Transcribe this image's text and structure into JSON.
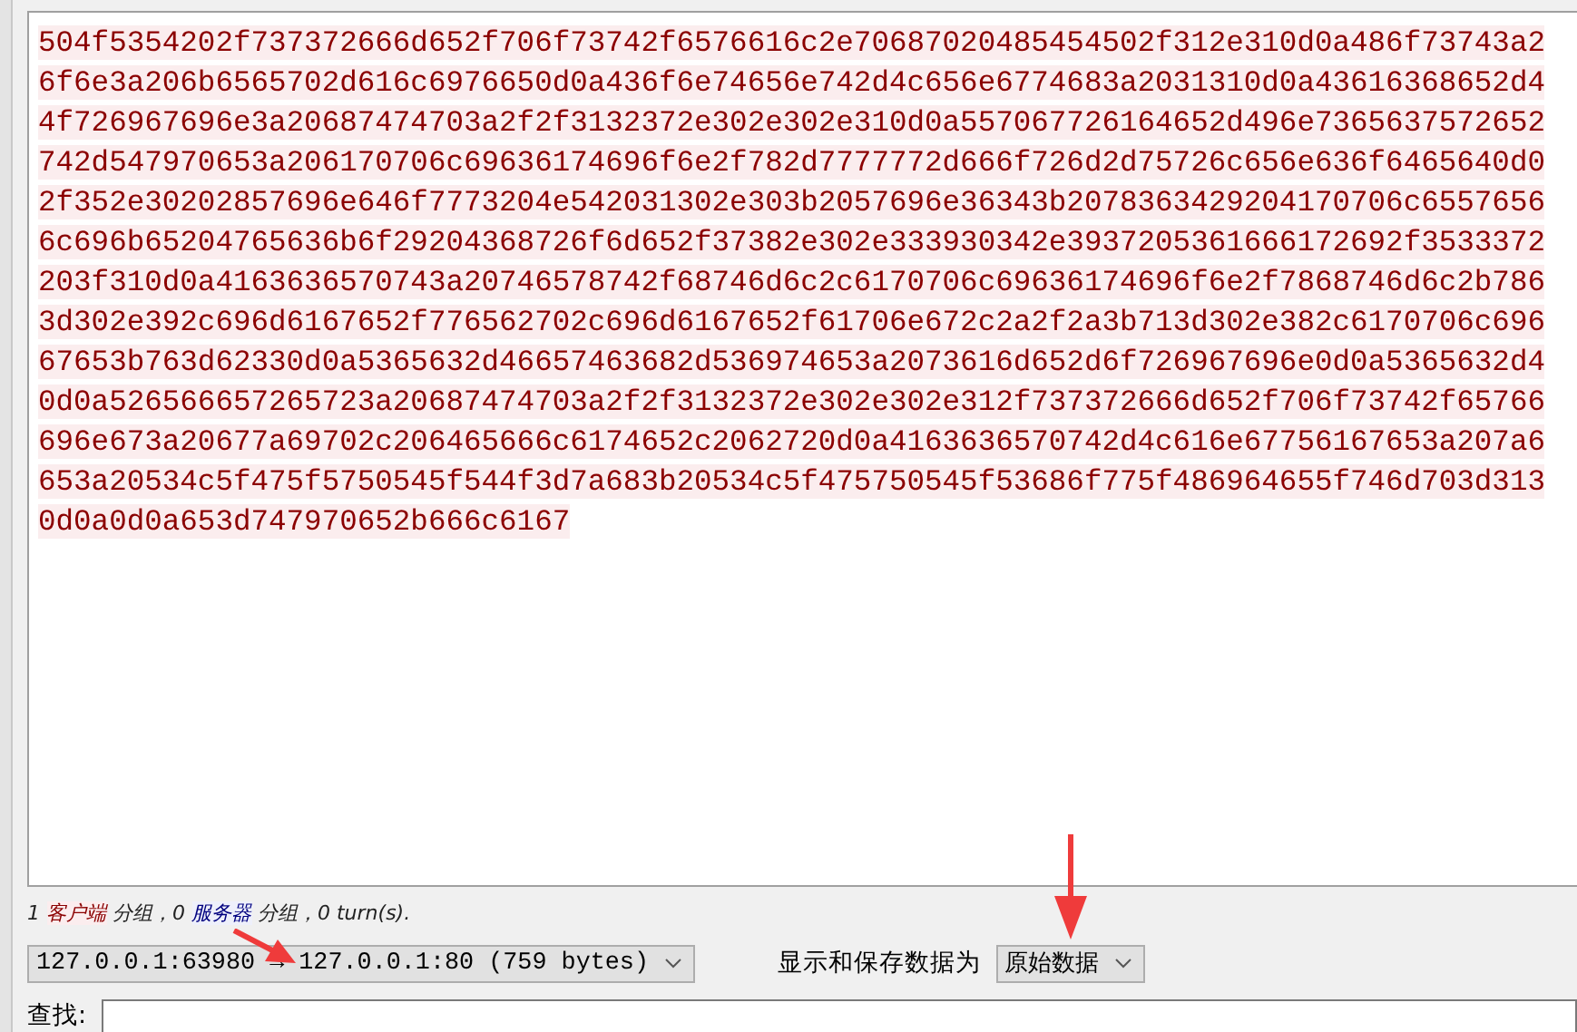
{
  "stream": {
    "lines": [
      "504f5354202f737372666d652f706f73742f6576616c2e70687020485454502f312e310d0a486f73743a2",
      "6f6e3a206b6565702d616c6976650d0a436f6e74656e742d4c656e6774683a2031310d0a43616368652d4",
      "4f726967696e3a20687474703a2f2f3132372e302e302e310d0a557067726164652d496e7365637572652",
      "742d547970653a206170706c69636174696f6e2f782d7777772d666f726d2d75726c656e636f6465640d0",
      "2f352e30202857696e646f7773204e542031302e303b2057696e36343b2078363429204170706c6557656",
      "6c696b65204765636b6f29204368726f6d652f37382e302e333930342e3937205361666172692f3533372",
      "203f310d0a4163636570743a20746578742f68746d6c2c6170706c69636174696f6e2f7868746d6c2b786",
      "3d302e392c696d6167652f776562702c696d6167652f61706e672c2a2f2a3b713d302e382c6170706c696",
      "67653b763d62330d0a5365632d46657463682d536974653a2073616d652d6f726967696e0d0a5365632d4",
      "0d0a526566657265723a20687474703a2f2f3132372e302e302e312f737372666d652f706f73742f65766",
      "696e673a20677a69702c206465666c6174652c2062720d0a4163636570742d4c616e67756167653a207a6",
      "653a20534c5f475f5750545f544f3d7a683b20534c5f475750545f53686f775f486964655f746d703d313",
      "0d0a0d0a653d747970652b666c6167"
    ]
  },
  "summary": [
    {
      "kind": "plain",
      "text": "1"
    },
    {
      "kind": "client",
      "text": "客户端"
    },
    {
      "kind": "plain",
      "text": "分组，0"
    },
    {
      "kind": "server",
      "text": "服务器"
    },
    {
      "kind": "plain",
      "text": "分组，0 turn(s)."
    }
  ],
  "conversation": {
    "value": "127.0.0.1:63980 → 127.0.0.1:80 (759 bytes)"
  },
  "display_label": "显示和保存数据为",
  "display_format": {
    "value": "原始数据"
  },
  "find": {
    "label": "查找:"
  }
}
